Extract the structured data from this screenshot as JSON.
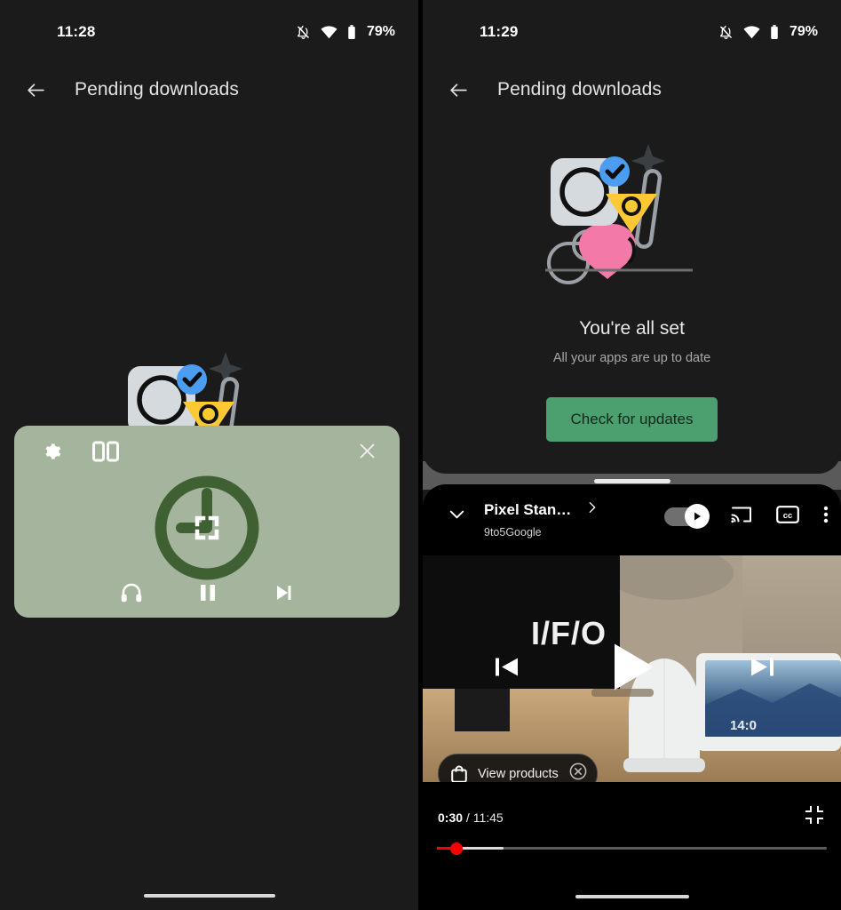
{
  "left_screen": {
    "status_bar": {
      "time": "11:28",
      "battery_percent": "79%",
      "icons": [
        "notifications-silenced-icon",
        "wifi-icon",
        "battery-icon"
      ]
    },
    "app_bar": {
      "back_icon": "back-arrow-icon",
      "title": "Pending downloads"
    },
    "illustration": {
      "name": "all-apps-up-to-date-illustration",
      "colors": {
        "square": "#d4dadd",
        "check_badge": "#4a9df0",
        "triangle": "#fcc834",
        "heart": "#f37aa8",
        "outline": "#9aa0a6"
      }
    },
    "pip_window": {
      "app": "clock-app",
      "background_color": "#a4b49d",
      "logo_color": "#3f6033",
      "icons": {
        "settings": "gear-icon",
        "split_screen": "split-screen-icon",
        "close": "close-icon",
        "expand": "fullscreen-expand-icon",
        "headphones": "headphones-icon",
        "pause": "pause-icon",
        "next": "next-track-icon"
      }
    },
    "gesture_bar": "home-gesture-bar"
  },
  "right_screen": {
    "status_bar": {
      "time": "11:29",
      "battery_percent": "79%",
      "icons": [
        "notifications-silenced-icon",
        "wifi-icon",
        "battery-icon"
      ]
    },
    "top_app": {
      "app_bar": {
        "back_icon": "back-arrow-icon",
        "title": "Pending downloads"
      },
      "empty_state": {
        "title": "You're all set",
        "subtitle": "All your apps are up to date",
        "button_label": "Check for updates",
        "button_color": "#4CA070"
      }
    },
    "split_handle": "split-screen-divider-handle",
    "bottom_app": {
      "name": "youtube-player",
      "video_title": "Pixel Stan…",
      "channel": "9to5Google",
      "header_icons": {
        "collapse": "chevron-down-icon",
        "expand_title": "chevron-right-icon",
        "autoplay": "autoplay-toggle",
        "autoplay_state": "on",
        "cast": "cast-icon",
        "captions": "closed-captions-icon",
        "overflow": "more-vertical-icon"
      },
      "player_controls": {
        "previous": "previous-track-icon",
        "play": "play-icon",
        "next": "next-track-icon"
      },
      "shopping_chip": {
        "label": "View products",
        "bag_icon": "shopping-bag-icon",
        "dismiss_icon": "close-circle-icon"
      },
      "timeline": {
        "current_time": "0:30",
        "separator": "/",
        "duration": "11:45",
        "progress_percent": 5,
        "buffered_percent": 17,
        "scrubber_color": "#ff0000"
      },
      "fullscreen_icon": "minimize-icon"
    },
    "gesture_bar": "home-gesture-bar"
  }
}
